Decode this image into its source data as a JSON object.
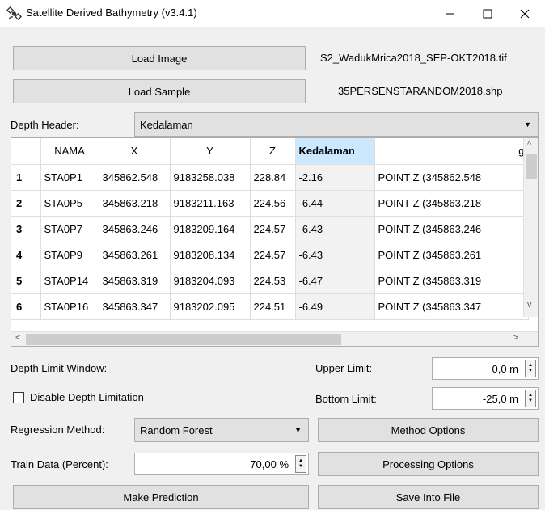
{
  "window": {
    "title": "Satellite Derived Bathymetry (v3.4.1)",
    "minimize_glyph": "—",
    "maximize_glyph": "☐",
    "close_glyph": "✕"
  },
  "load": {
    "image_button": "Load Image",
    "image_file": "S2_WadukMrica2018_SEP-OKT2018.tif",
    "sample_button": "Load Sample",
    "sample_file": "35PERSENSTARANDOM2018.shp"
  },
  "depth_header": {
    "label": "Depth Header:",
    "value": "Kedalaman"
  },
  "table": {
    "columns": [
      "",
      "NAMA",
      "X",
      "Y",
      "Z",
      "Kedalaman",
      "g"
    ],
    "rows": [
      [
        "1",
        "STA0P1",
        "345862.548",
        "9183258.038",
        "228.84",
        "-2.16",
        "POINT Z (345862.548"
      ],
      [
        "2",
        "STA0P5",
        "345863.218",
        "9183211.163",
        "224.56",
        "-6.44",
        "POINT Z (345863.218"
      ],
      [
        "3",
        "STA0P7",
        "345863.246",
        "9183209.164",
        "224.57",
        "-6.43",
        "POINT Z (345863.246"
      ],
      [
        "4",
        "STA0P9",
        "345863.261",
        "9183208.134",
        "224.57",
        "-6.43",
        "POINT Z (345863.261"
      ],
      [
        "5",
        "STA0P14",
        "345863.319",
        "9183204.093",
        "224.53",
        "-6.47",
        "POINT Z (345863.319"
      ],
      [
        "6",
        "STA0P16",
        "345863.347",
        "9183202.095",
        "224.51",
        "-6.49",
        "POINT Z (345863.347"
      ]
    ]
  },
  "depth_limit": {
    "window_label": "Depth Limit Window:",
    "disable_label": "Disable Depth Limitation",
    "upper_label": "Upper Limit:",
    "upper_value": "0,0 m",
    "bottom_label": "Bottom Limit:",
    "bottom_value": "-25,0 m"
  },
  "regression": {
    "label": "Regression Method:",
    "value": "Random Forest",
    "options_button": "Method Options"
  },
  "train": {
    "label": "Train Data (Percent):",
    "value": "70,00 %",
    "processing_button": "Processing Options"
  },
  "actions": {
    "predict_button": "Make Prediction",
    "save_button": "Save Into File"
  },
  "colors": {
    "highlight_header": "#cce8ff",
    "button_face": "#e1e1e1"
  }
}
